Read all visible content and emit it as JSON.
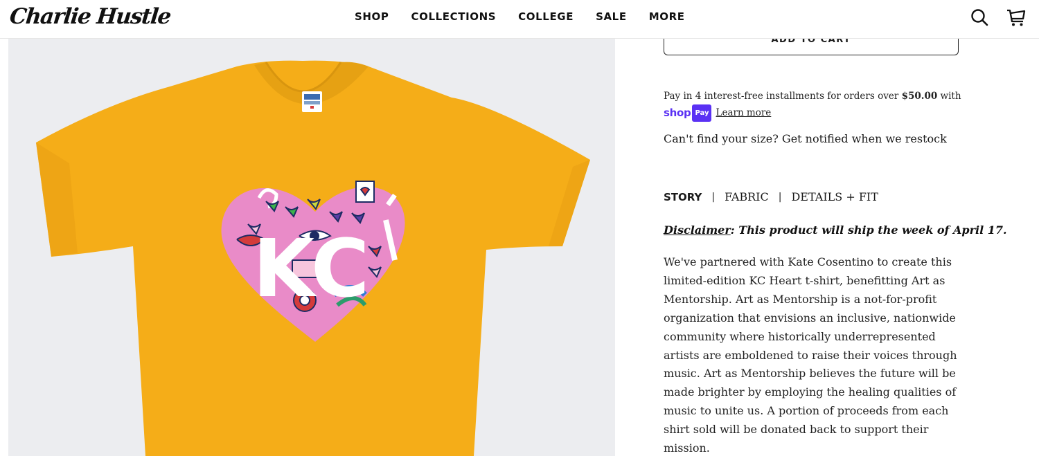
{
  "header": {
    "logo": "Charlie Hustle",
    "nav": [
      "SHOP",
      "COLLECTIONS",
      "COLLEGE",
      "SALE",
      "MORE"
    ]
  },
  "product": {
    "image_alt": "Gold KC Heart t-shirt",
    "shirt_color": "#f5ad18",
    "heart_color": "#e98bc8",
    "heart_text": "KC"
  },
  "purchase": {
    "add_to_cart": "ADD TO CART",
    "installments_prefix": "Pay in 4 interest-free installments for orders over ",
    "installments_amount": "$50.00",
    "installments_suffix": " with",
    "shop_logo": "shop",
    "pay_badge": "Pay",
    "learn_more": "Learn more",
    "restock_notice": "Can't find your size? Get notified when we restock"
  },
  "tabs": [
    "STORY",
    "FABRIC",
    "DETAILS + FIT"
  ],
  "disclaimer": {
    "label": "Disclaimer",
    "text": ":  This product will ship the week of April 17."
  },
  "story": "We've partnered with Kate Cosentino to create this limited-edition KC Heart t-shirt, benefitting Art as Mentorship. Art as Mentorship is a not-for-profit organization that envisions an inclusive, nationwide community where historically underrepresented artists are emboldened to raise their voices through music. Art as Mentorship believes the future will be made brighter by employing the healing qualities of music to unite us. A portion of proceeds from each shirt sold will be donated back to support their mission.",
  "colors": {
    "brand_purple": "#5a31f4",
    "text": "#1a1a1a"
  }
}
